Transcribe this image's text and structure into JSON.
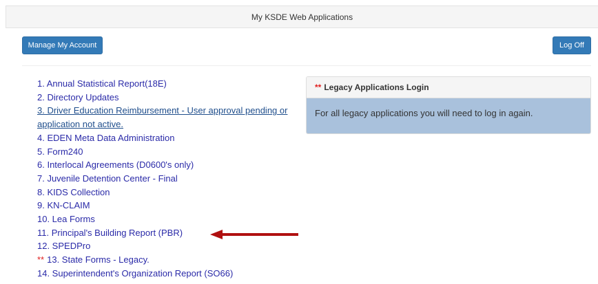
{
  "header": {
    "title": "My KSDE Web Applications"
  },
  "toolbar": {
    "manage_label": "Manage My Account",
    "logoff_label": "Log Off"
  },
  "apps": [
    {
      "label": "1. Annual Statistical Report(18E)"
    },
    {
      "label": "2. Directory Updates"
    },
    {
      "label": "3. Driver Education Reimbursement - User approval pending or application not active."
    },
    {
      "label": "4. EDEN Meta Data Administration"
    },
    {
      "label": "5. Form240"
    },
    {
      "label": "6. Interlocal Agreements (D0600's only)"
    },
    {
      "label": "7. Juvenile Detention Center - Final"
    },
    {
      "label": "8. KIDS Collection"
    },
    {
      "label": "9. KN-CLAIM"
    },
    {
      "label": "10. Lea Forms"
    },
    {
      "label": "11. Principal's Building Report (PBR)"
    },
    {
      "label": "12. SPEDPro"
    },
    {
      "label": "13. State Forms - Legacy.",
      "legacy_marker": "**"
    },
    {
      "label": "14. Superintendent's Organization Report (SO66)"
    }
  ],
  "legacy_panel": {
    "marker": "**",
    "title": "Legacy Applications Login",
    "message": "For all legacy applications you will need to log in again."
  },
  "colors": {
    "button": "#337ab7",
    "link": "#2a2aa8",
    "legacy_marker": "#e02020",
    "arrow": "#b01010",
    "panel_body": "#a9c1dc"
  },
  "icons": {
    "annotation_arrow": "left-arrow-icon"
  }
}
